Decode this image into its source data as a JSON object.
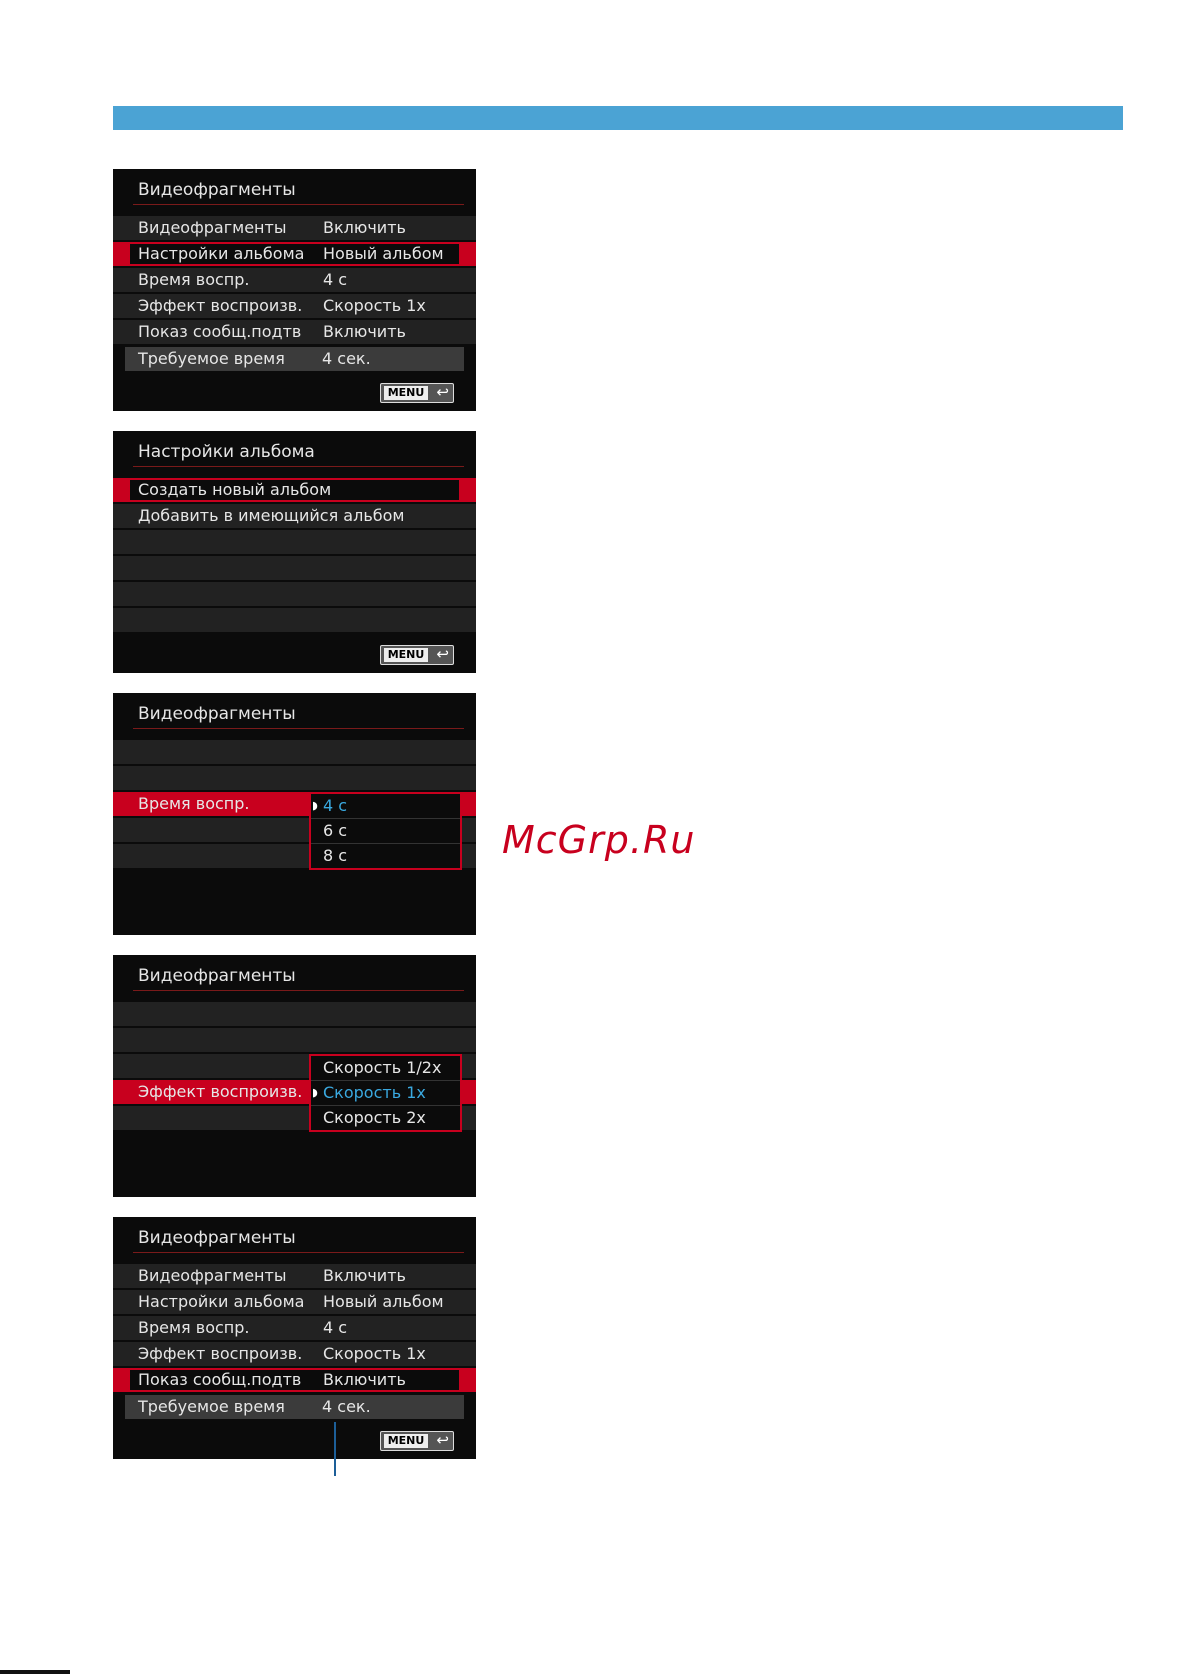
{
  "screen1": {
    "title": "Видеофрагменты",
    "rows": [
      {
        "label": "Видеофрагменты",
        "value": "Включить"
      },
      {
        "label": "Настройки альбома",
        "value": "Новый альбом"
      },
      {
        "label": "Время воспр.",
        "value": "4 с"
      },
      {
        "label": "Эффект воспроизв.",
        "value": "Скорость 1x"
      },
      {
        "label": "Показ сообщ.подтв",
        "value": "Включить"
      }
    ],
    "required": {
      "label": "Требуемое время",
      "value": "4 сек."
    },
    "menu_label": "MENU"
  },
  "screen2": {
    "title": "Настройки альбома",
    "items": [
      "Создать новый альбом",
      "Добавить в имеющийся альбом"
    ],
    "menu_label": "MENU"
  },
  "screen3": {
    "title": "Видеофрагменты",
    "row_label": "Время воспр.",
    "options": [
      "4 с",
      "6 с",
      "8 с"
    ]
  },
  "screen4": {
    "title": "Видеофрагменты",
    "row_label": "Эффект воспроизв.",
    "options": [
      "Скорость 1/2x",
      "Скорость 1x",
      "Скорость 2x"
    ]
  },
  "screen5": {
    "title": "Видеофрагменты",
    "rows": [
      {
        "label": "Видеофрагменты",
        "value": "Включить"
      },
      {
        "label": "Настройки альбома",
        "value": "Новый альбом"
      },
      {
        "label": "Время воспр.",
        "value": "4 с"
      },
      {
        "label": "Эффект воспроизв.",
        "value": "Скорость 1x"
      },
      {
        "label": "Показ сообщ.подтв",
        "value": "Включить"
      }
    ],
    "required": {
      "label": "Требуемое время",
      "value": "4 сек."
    },
    "menu_label": "MENU"
  },
  "watermark": "McGrp.Ru",
  "colors": {
    "header": "#4ba3d4",
    "highlight": "#c8001e",
    "selected_text": "#3aa9e0",
    "callout": "#1d5f98"
  }
}
